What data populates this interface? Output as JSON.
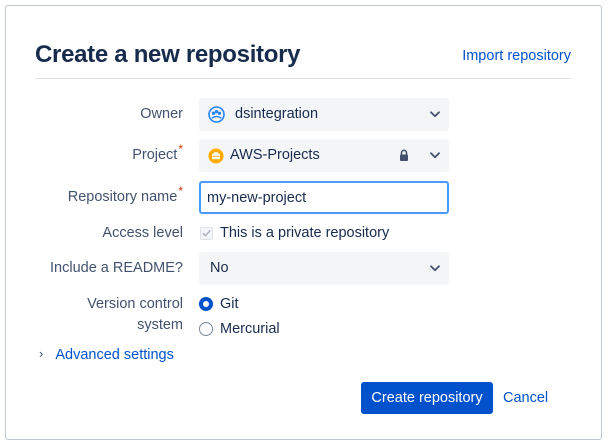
{
  "header": {
    "title": "Create a new repository",
    "import_link": "Import repository"
  },
  "form": {
    "owner": {
      "label": "Owner",
      "value": "dsintegration",
      "icon": "team-avatar-icon"
    },
    "project": {
      "label": "Project",
      "required_marker": "*",
      "value": "AWS-Projects",
      "icon": "project-avatar-icon",
      "locked": true
    },
    "repository_name": {
      "label": "Repository name",
      "required_marker": "*",
      "value": "my-new-project"
    },
    "access_level": {
      "label": "Access level",
      "checkbox_label": "This is a private repository",
      "checked": true
    },
    "readme": {
      "label": "Include a README?",
      "value": "No"
    },
    "vcs": {
      "label_line1": "Version control",
      "label_line2": "system",
      "options": [
        {
          "label": "Git",
          "selected": true
        },
        {
          "label": "Mercurial",
          "selected": false
        }
      ]
    },
    "advanced": {
      "chevron": "›",
      "label": "Advanced settings"
    }
  },
  "actions": {
    "create_label": "Create repository",
    "cancel_label": "Cancel"
  },
  "colors": {
    "primary": "#0052cc",
    "link": "#0052cc",
    "required": "#de350b",
    "focus_border": "#4c9aff",
    "field_bg": "#f4f5f7",
    "project_avatar": "#ffab00"
  }
}
